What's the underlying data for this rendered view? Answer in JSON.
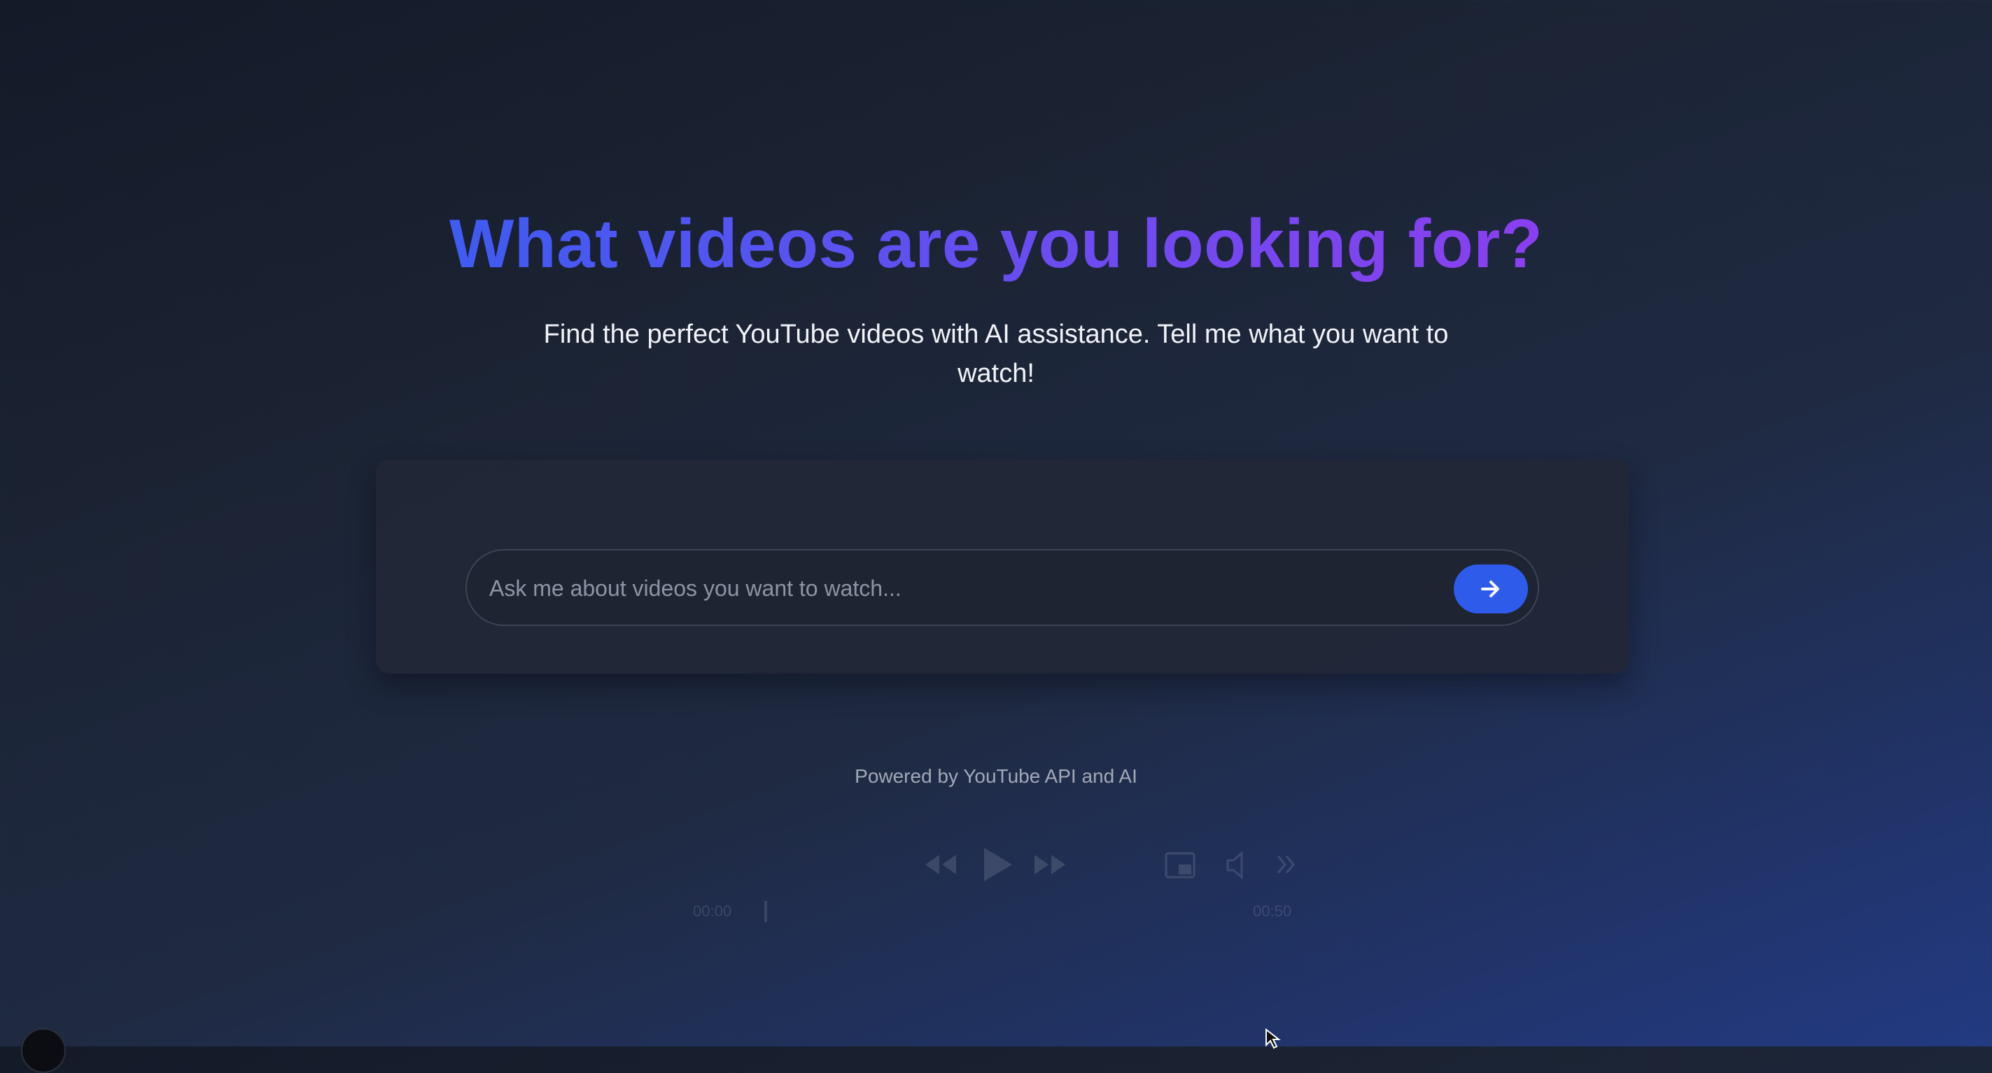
{
  "hero": {
    "title": "What videos are you looking for?",
    "subtitle": "Find the perfect YouTube videos with AI assistance. Tell me what you want to watch!"
  },
  "search": {
    "placeholder": "Ask me about videos you want to watch...",
    "value": "",
    "submit_icon": "arrow-right-icon"
  },
  "footer": {
    "powered_by": "Powered by YouTube API and AI"
  },
  "player": {
    "current_time": "00:00",
    "duration": "00:50",
    "icons": [
      "rewind-icon",
      "play-icon",
      "fast-forward-icon",
      "picture-in-picture-icon",
      "volume-icon",
      "more-icon"
    ]
  },
  "colors": {
    "accent": "#2f5bea",
    "title_gradient_start": "#3f5bf2",
    "title_gradient_end": "#8a3ff0",
    "background_top": "#131a28",
    "background_bottom": "#223a82"
  }
}
